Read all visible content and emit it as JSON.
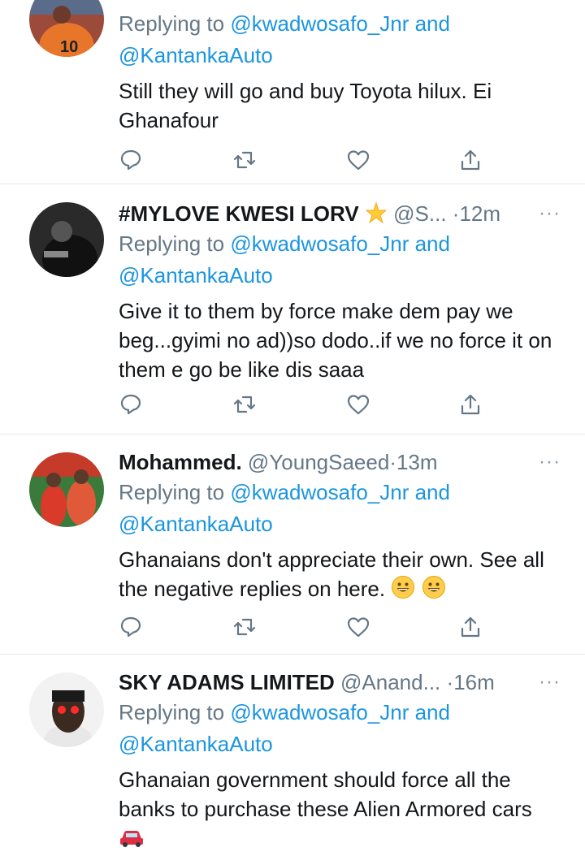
{
  "tweets": [
    {
      "name": "",
      "handle": "",
      "time": "",
      "replying_prefix": "Replying to ",
      "mention1": "@kwadwosafo_Jnr",
      "and": " and",
      "mention2": "@KantankaAuto",
      "text": "Still they will go and buy Toyota hilux. Ei Ghanafour"
    },
    {
      "name": "#MYLOVE KWESI LORV",
      "handle": "@S...",
      "time": "12m",
      "replying_prefix": "Replying to ",
      "mention1": "@kwadwosafo_Jnr",
      "and": " and",
      "mention2": "@KantankaAuto",
      "text": "Give it to them by force make dem pay we beg...gyimi no ad))so dodo..if we no force it on them e go be like dis saaa"
    },
    {
      "name": "Mohammed.",
      "handle": "@YoungSaeed",
      "time": "13m",
      "replying_prefix": "Replying to ",
      "mention1": "@kwadwosafo_Jnr",
      "and": " and",
      "mention2": "@KantankaAuto",
      "text": "Ghanaians don't appreciate their own. See all the negative replies on here."
    },
    {
      "name": "SKY ADAMS LIMITED",
      "handle": "@Anand...",
      "time": "16m",
      "replying_prefix": "Replying to ",
      "mention1": "@kwadwosafo_Jnr",
      "and": " and",
      "mention2": "@KantankaAuto",
      "text": "Ghanaian government should force all the banks to purchase these Alien Armored cars"
    }
  ],
  "separator": "·",
  "more_glyph": "···",
  "colors": {
    "link": "#1b95e0",
    "muted": "#657786",
    "divider": "#e1e8ed"
  },
  "icons": [
    "reply-icon",
    "retweet-icon",
    "like-icon",
    "share-icon"
  ]
}
